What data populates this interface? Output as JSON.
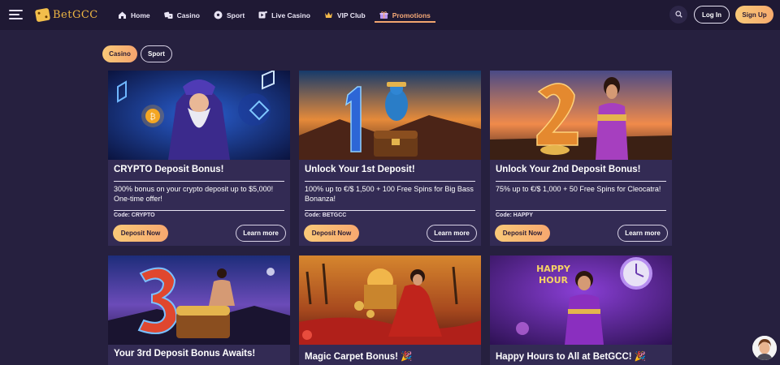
{
  "header": {
    "logo_text": "BetGCC",
    "nav": [
      {
        "label": "Home",
        "icon": "home-icon"
      },
      {
        "label": "Casino",
        "icon": "dice-icon"
      },
      {
        "label": "Sport",
        "icon": "soccer-ball-icon"
      },
      {
        "label": "Live Casino",
        "icon": "live-casino-icon"
      },
      {
        "label": "VIP Club",
        "icon": "crown-icon"
      },
      {
        "label": "Promotions",
        "icon": "gift-icon",
        "active": true
      }
    ],
    "login_label": "Log In",
    "signup_label": "Sign Up"
  },
  "filters": {
    "tabs": [
      {
        "label": "Casino",
        "active": true
      },
      {
        "label": "Sport",
        "active": false
      }
    ]
  },
  "promos": [
    {
      "title": "CRYPTO Deposit Bonus!",
      "description": "300% bonus on your crypto deposit up to $5,000! One-time offer!",
      "code": "Code: CRYPTO",
      "deposit_label": "Deposit Now",
      "learn_label": "Learn more"
    },
    {
      "title": "Unlock Your 1st Deposit!",
      "description": "100% up to €/$ 1,500 + 100 Free Spins for Big Bass Bonanza!",
      "code": "Code: BETGCC",
      "deposit_label": "Deposit Now",
      "learn_label": "Learn more"
    },
    {
      "title": "Unlock Your 2nd Deposit Bonus!",
      "description": "75% up to €/$ 1,000 + 50 Free Spins for Cleocatra!",
      "code": "Code: HAPPY",
      "deposit_label": "Deposit Now",
      "learn_label": "Learn more"
    },
    {
      "title": "Your 3rd Deposit Bonus Awaits!"
    },
    {
      "title": "Magic Carpet Bonus! 🎉"
    },
    {
      "title": "Happy Hours to All at BetGCC! 🎉"
    }
  ],
  "banners": {
    "happy_hour_line1": "HAPPY",
    "happy_hour_line2": "HOUR"
  },
  "colors": {
    "page_bg": "#26203f",
    "header_bg": "#1f1934",
    "card_bg": "#332b54",
    "accent_gradient_start": "#f9c978",
    "accent_gradient_end": "#f7a86f",
    "active_nav": "#f6a977"
  }
}
